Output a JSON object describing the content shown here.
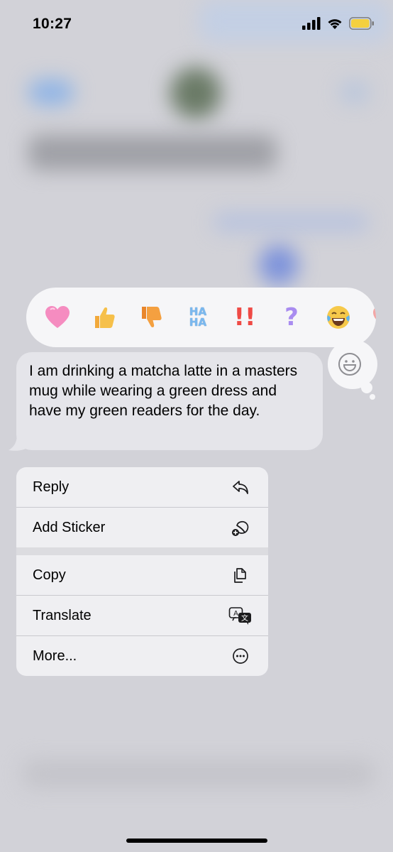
{
  "status_bar": {
    "time": "10:27",
    "battery_color": "#f4d03f",
    "icons": [
      "signal-icon",
      "wifi-icon",
      "battery-icon"
    ]
  },
  "reactions": [
    {
      "name": "heart-reaction",
      "glyph": "🩷",
      "color": "#f07fb6"
    },
    {
      "name": "thumbs-up-reaction",
      "glyph": "👍",
      "color": "#f4b73d"
    },
    {
      "name": "thumbs-down-reaction",
      "glyph": "👎",
      "color": "#f39c38"
    },
    {
      "name": "haha-reaction",
      "glyph": "HA HA",
      "color": "#7ab8ee"
    },
    {
      "name": "exclamation-reaction",
      "glyph": "‼",
      "color": "#ef4a45"
    },
    {
      "name": "question-reaction",
      "glyph": "?",
      "color": "#a98cf0"
    },
    {
      "name": "laughing-reaction",
      "glyph": "😂",
      "color": "#f6c94a"
    },
    {
      "name": "partial-heart-reaction",
      "glyph": "❤",
      "color": "#f2a6a6"
    }
  ],
  "message": {
    "text": "I am drinking a matcha latte in a masters mug while wearing a green dress and have my green readers for the day."
  },
  "menu": {
    "items": [
      {
        "label": "Reply",
        "icon": "reply-icon"
      },
      {
        "label": "Add Sticker",
        "icon": "add-sticker-icon"
      },
      {
        "label": "Copy",
        "icon": "copy-icon"
      },
      {
        "label": "Translate",
        "icon": "translate-icon"
      },
      {
        "label": "More...",
        "icon": "more-icon"
      }
    ]
  }
}
